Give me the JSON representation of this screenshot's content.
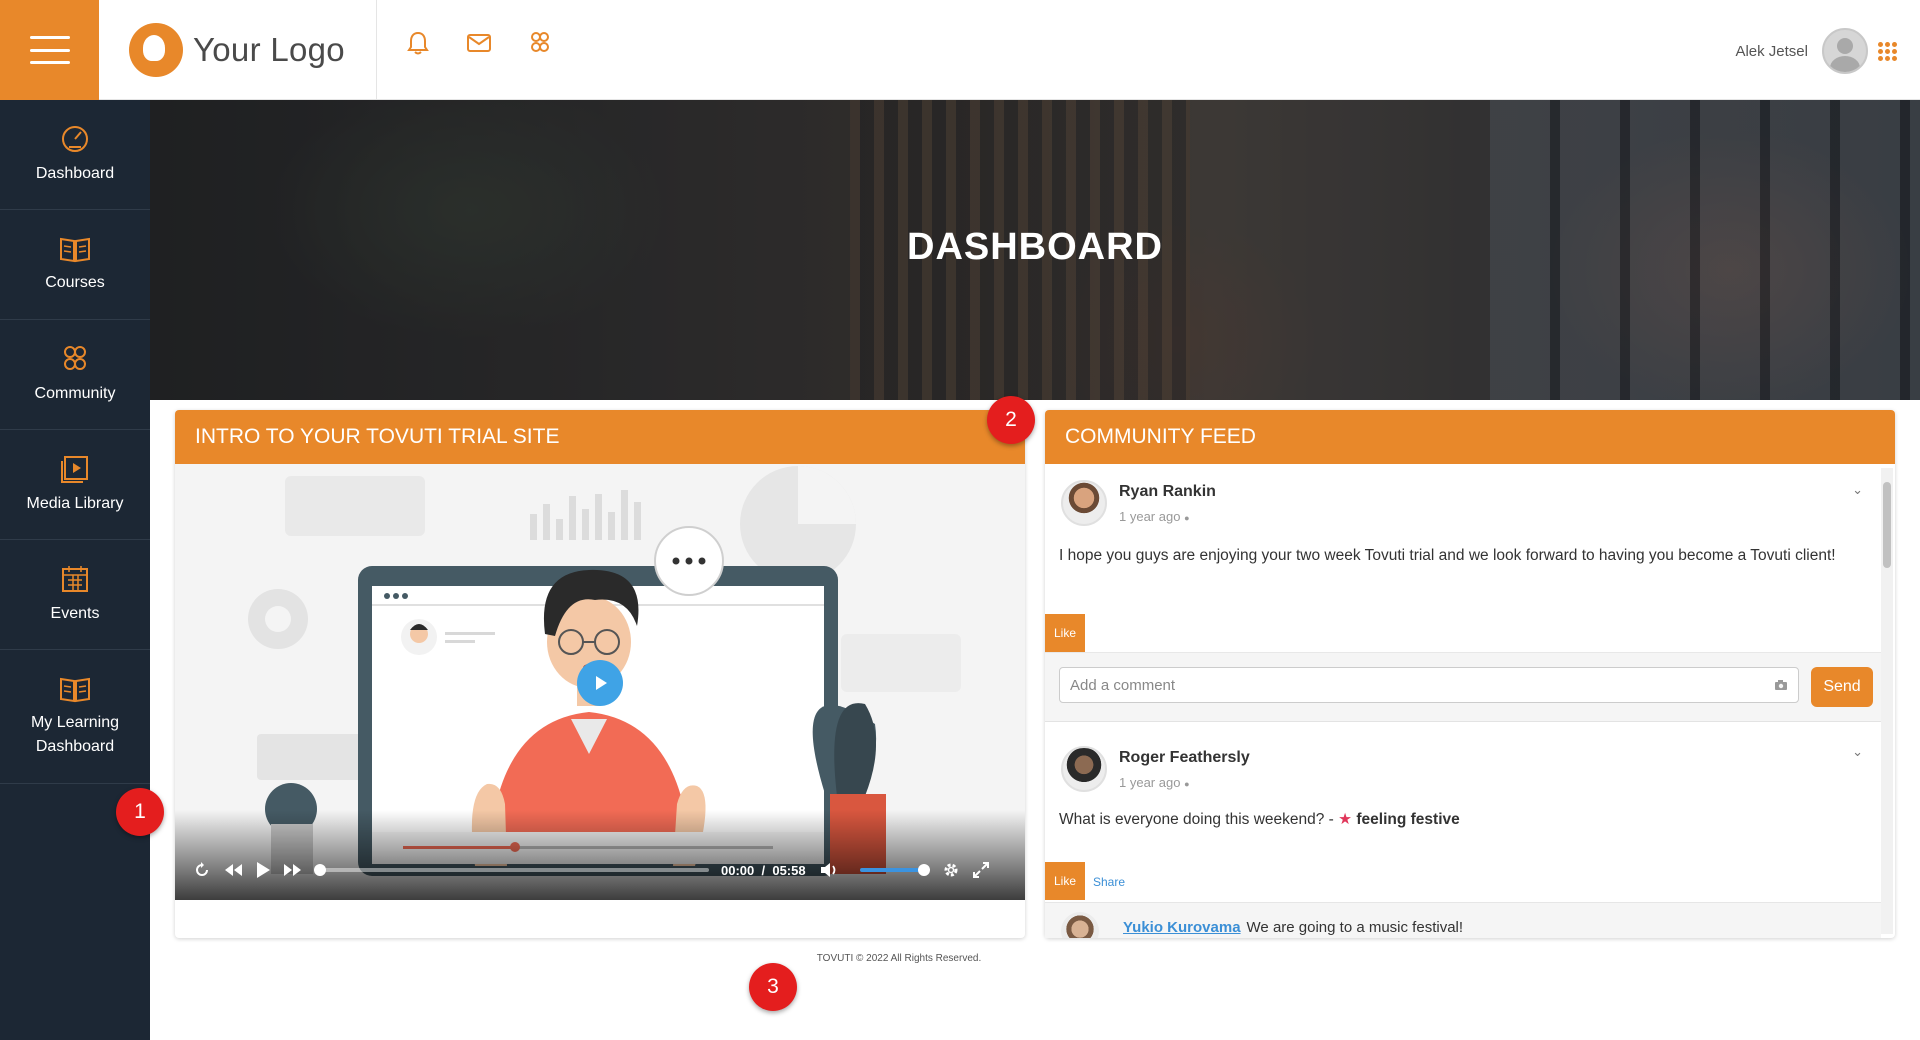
{
  "header": {
    "logo_text": "Your Logo",
    "icons": [
      "bell-icon",
      "mail-icon",
      "community-icon"
    ],
    "user_name": "Alek Jetsel"
  },
  "sidebar": {
    "items": [
      {
        "label": "Dashboard",
        "icon": "dashboard-icon"
      },
      {
        "label": "Courses",
        "icon": "book-icon"
      },
      {
        "label": "Community",
        "icon": "community-icon"
      },
      {
        "label": "Media Library",
        "icon": "media-icon"
      },
      {
        "label": "Events",
        "icon": "calendar-icon"
      },
      {
        "label": "My Learning Dashboard",
        "icon": "book-icon"
      }
    ]
  },
  "hero": {
    "title": "DASHBOARD"
  },
  "intro_panel": {
    "title": "INTRO TO YOUR TOVUTI TRIAL SITE",
    "video": {
      "current_time": "00:00",
      "separator": "/",
      "duration": "05:58",
      "progress": 0,
      "volume": 1
    }
  },
  "feed_panel": {
    "title": "COMMUNITY FEED",
    "posts": [
      {
        "author": "Ryan Rankin",
        "time": "1 year ago",
        "text": "I hope you guys are enjoying your two week Tovuti trial and we look forward to having you become a Tovuti client!",
        "like_label": "Like",
        "comment_placeholder": "Add a comment",
        "send_label": "Send"
      },
      {
        "author": "Roger Feathersly",
        "time": "1 year ago",
        "text": "What is everyone doing this weekend? - ",
        "feeling": "feeling festive",
        "like_label": "Like",
        "share_label": "Share",
        "reply": {
          "author": "Yukio Kurovama",
          "text": "We are going to a music festival!"
        }
      }
    ]
  },
  "footer": {
    "text": "TOVUTI © 2022 All Rights Reserved."
  },
  "badges": [
    "1",
    "2",
    "3"
  ],
  "colors": {
    "accent": "#e8882a",
    "sidebar": "#1c2734",
    "badge": "#e41e1e",
    "link": "#3b8fd6"
  }
}
